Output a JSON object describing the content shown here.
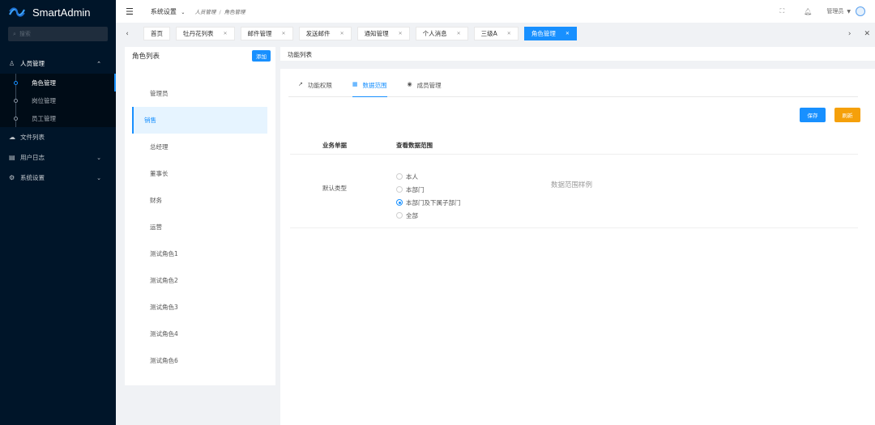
{
  "app": {
    "name": "SmartAdmin"
  },
  "sidebar": {
    "search_placeholder": "搜索",
    "menu": [
      {
        "label": "人员管理",
        "icon": "user-group-icon",
        "open": true,
        "children": [
          {
            "label": "角色管理",
            "active": true
          },
          {
            "label": "岗位管理",
            "active": false
          },
          {
            "label": "员工管理",
            "active": false
          }
        ]
      },
      {
        "label": "文件列表",
        "icon": "cloud-icon"
      },
      {
        "label": "用户日志",
        "icon": "log-icon"
      },
      {
        "label": "系统设置",
        "icon": "settings-icon"
      }
    ]
  },
  "header": {
    "system_select": "系统设置",
    "breadcrumb": [
      "人员管理",
      "角色管理"
    ],
    "user": "管理员"
  },
  "tabs": [
    {
      "label": "首页",
      "closable": false,
      "active": false
    },
    {
      "label": "牡丹花列表",
      "closable": true,
      "active": false
    },
    {
      "label": "邮件管理",
      "closable": true,
      "active": false
    },
    {
      "label": "发送邮件",
      "closable": true,
      "active": false
    },
    {
      "label": "通知管理",
      "closable": true,
      "active": false
    },
    {
      "label": "个人消息",
      "closable": true,
      "active": false
    },
    {
      "label": "三级A",
      "closable": true,
      "active": false
    },
    {
      "label": "角色管理",
      "closable": true,
      "active": true
    }
  ],
  "roles_panel": {
    "title": "角色列表",
    "add_label": "添加",
    "roles": [
      "管理员",
      "销售",
      "总经理",
      "董事长",
      "财务",
      "运营",
      "测试角色1",
      "测试角色2",
      "测试角色3",
      "测试角色4",
      "测试角色6"
    ],
    "active_role": "销售"
  },
  "func_panel": {
    "title": "功能列表",
    "tabs": [
      {
        "label": "功能权限",
        "icon": "pointer-icon"
      },
      {
        "label": "数据范围",
        "icon": "table-icon",
        "active": true
      },
      {
        "label": "成员管理",
        "icon": "eye-icon"
      }
    ],
    "save_label": "保存",
    "refresh_label": "刷新",
    "columns": [
      "业务单据",
      "查看数据范围"
    ],
    "row": {
      "name": "默认类型",
      "options": [
        "本人",
        "本部门",
        "本部门及下属子部门",
        "全部"
      ],
      "selected": "本部门及下属子部门",
      "example": "数据范围样例"
    }
  }
}
